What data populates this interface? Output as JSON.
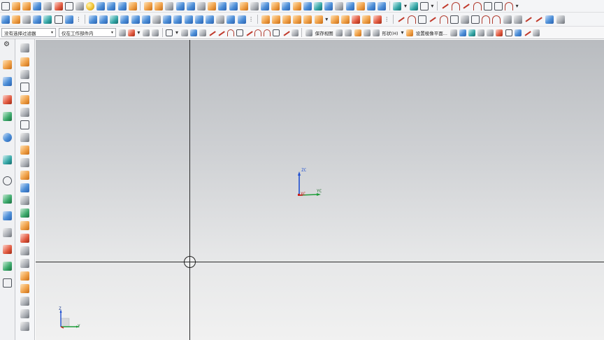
{
  "toolbar": {
    "selection_filter": "没有选择过滤器",
    "selection_scope": "仅在工作部件内",
    "save_view_label": "保存视图",
    "shape_label": "形状(H)",
    "set_work_plane_label": "设置棱像平面..."
  },
  "left_panel": {
    "gear_label": "⚙"
  },
  "viewport": {
    "wcs": {
      "z_label": "ZC",
      "y_label": "YC",
      "x_label": "XC"
    },
    "absolute_csys": {
      "z_label": "Z",
      "y_label": "Y"
    }
  },
  "colors": {
    "accent_blue": "#2a62b0",
    "accent_orange": "#f0a24a",
    "axis_z": "#1f4fd1",
    "axis_y": "#1e9e3a",
    "axis_x": "#c8201c"
  }
}
